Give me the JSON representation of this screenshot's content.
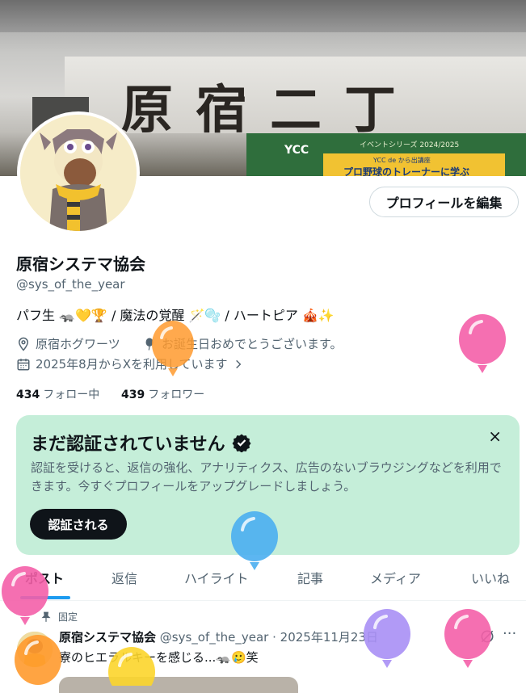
{
  "banner": {
    "sign_text": "原宿二丁",
    "store_logo": "YCC",
    "store_sub": "イベントシリーズ 2024/2025",
    "poster_tag": "YCC de から出講座",
    "poster_text": "プロ野球のトレーナーに学ぶ"
  },
  "profile": {
    "edit_button": "プロフィールを編集",
    "name": "原宿システマ協会",
    "handle": "@sys_of_the_year",
    "bio": "パフ生 🦡💛🏆 / 魔法の覚醒 🪄🫧 / ハートピア 🎪✨",
    "location": "原宿ホグワーツ",
    "birthday": "お誕生日おめでとうございます。",
    "joined": "2025年8月からXを利用しています",
    "following_count": "434",
    "following_label": "フォロー中",
    "followers_count": "439",
    "followers_label": "フォロワー"
  },
  "promo": {
    "title": "まだ認証されていません",
    "description": "認証を受けると、返信の強化、アナリティクス、広告のないブラウジングなどを利用できます。今すぐプロフィールをアップグレードしましょう。",
    "button": "認証される",
    "close": "×",
    "background": "#c5eed9"
  },
  "tabs": [
    {
      "label": "ポスト",
      "active": true
    },
    {
      "label": "返信",
      "active": false
    },
    {
      "label": "ハイライト",
      "active": false
    },
    {
      "label": "記事",
      "active": false
    },
    {
      "label": "メディア",
      "active": false
    },
    {
      "label": "いいね",
      "active": false
    }
  ],
  "post": {
    "pinned_label": "固定",
    "author": "原宿システマ協会",
    "meta": "@sys_of_the_year · 2025年11月23日",
    "text": "寮のヒエラルキーを感じる...🦡🥲笑",
    "more": "···"
  },
  "colors": {
    "accent": "#1d9bf0",
    "text": "#0f1419",
    "secondary": "#536471",
    "balloon_orange": "#ff9a2e",
    "balloon_pink": "#f45fa8",
    "balloon_blue": "#4aaef0",
    "balloon_purple": "#a98ff5",
    "balloon_yellow": "#fcd52b"
  },
  "icons": [
    "location-icon",
    "balloon-icon",
    "calendar-icon",
    "chevron-right-icon",
    "verified-icon",
    "close-icon",
    "pin-icon",
    "grok-icon",
    "more-icon"
  ]
}
